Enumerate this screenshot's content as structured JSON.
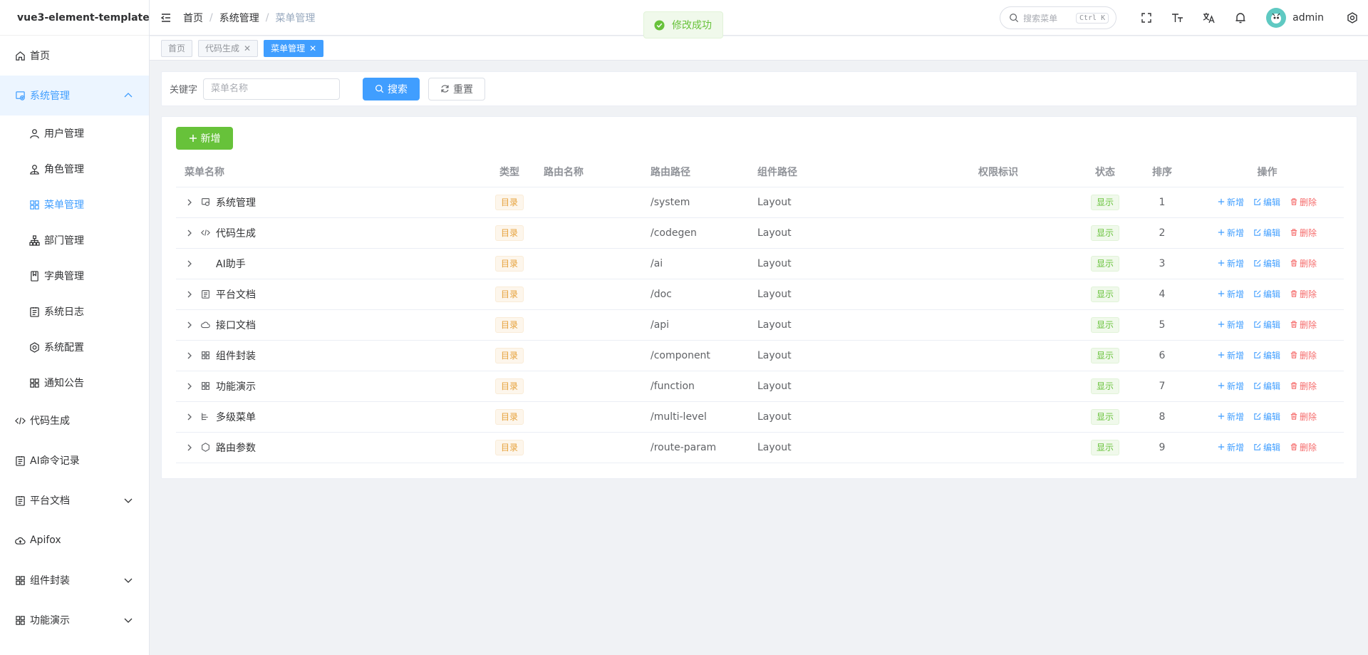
{
  "app": {
    "title": "vue3-element-template"
  },
  "sidebar": {
    "items": [
      {
        "label": "首页",
        "icon": "home-icon"
      },
      {
        "label": "系统管理",
        "icon": "system-icon",
        "expanded": true
      },
      {
        "label": "用户管理",
        "icon": "user-icon"
      },
      {
        "label": "角色管理",
        "icon": "role-icon"
      },
      {
        "label": "菜单管理",
        "icon": "grid-icon",
        "active": true
      },
      {
        "label": "部门管理",
        "icon": "org-icon"
      },
      {
        "label": "字典管理",
        "icon": "book-icon"
      },
      {
        "label": "系统日志",
        "icon": "log-icon"
      },
      {
        "label": "系统配置",
        "icon": "hex-settings-icon"
      },
      {
        "label": "通知公告",
        "icon": "grid-icon"
      },
      {
        "label": "代码生成",
        "icon": "code-icon"
      },
      {
        "label": "AI命令记录",
        "icon": "doc-icon"
      },
      {
        "label": "平台文档",
        "icon": "doc-icon",
        "has_children": true
      },
      {
        "label": "Apifox",
        "icon": "cloud-icon"
      },
      {
        "label": "组件封装",
        "icon": "grid-icon",
        "has_children": true
      },
      {
        "label": "功能演示",
        "icon": "grid-icon",
        "has_children": true
      }
    ]
  },
  "header": {
    "breadcrumb": [
      "首页",
      "系统管理",
      "菜单管理"
    ],
    "search_placeholder": "搜索菜单",
    "search_shortcut": "Ctrl K",
    "username": "admin"
  },
  "toast": {
    "message": "修改成功"
  },
  "tags": [
    {
      "label": "首页",
      "closable": false
    },
    {
      "label": "代码生成",
      "closable": true
    },
    {
      "label": "菜单管理",
      "closable": true,
      "active": true
    }
  ],
  "search": {
    "keyword_label": "关键字",
    "keyword_placeholder": "菜单名称",
    "search_button": "搜索",
    "reset_button": "重置"
  },
  "table": {
    "add_button": "新增",
    "columns": [
      "菜单名称",
      "类型",
      "路由名称",
      "路由路径",
      "组件路径",
      "权限标识",
      "状态",
      "排序",
      "操作"
    ],
    "op_labels": {
      "add": "新增",
      "edit": "编辑",
      "delete": "删除"
    },
    "rows": [
      {
        "name": "系统管理",
        "icon": "system-icon",
        "type": "目录",
        "route_name": "",
        "path": "/system",
        "component": "Layout",
        "perm": "",
        "status": "显示",
        "sort": "1"
      },
      {
        "name": "代码生成",
        "icon": "code-icon",
        "type": "目录",
        "route_name": "",
        "path": "/codegen",
        "component": "Layout",
        "perm": "",
        "status": "显示",
        "sort": "2"
      },
      {
        "name": "AI助手",
        "icon": "",
        "type": "目录",
        "route_name": "",
        "path": "/ai",
        "component": "Layout",
        "perm": "",
        "status": "显示",
        "sort": "3"
      },
      {
        "name": "平台文档",
        "icon": "doc-icon",
        "type": "目录",
        "route_name": "",
        "path": "/doc",
        "component": "Layout",
        "perm": "",
        "status": "显示",
        "sort": "4"
      },
      {
        "name": "接口文档",
        "icon": "cloud-icon",
        "type": "目录",
        "route_name": "",
        "path": "/api",
        "component": "Layout",
        "perm": "",
        "status": "显示",
        "sort": "5"
      },
      {
        "name": "组件封装",
        "icon": "grid-icon",
        "type": "目录",
        "route_name": "",
        "path": "/component",
        "component": "Layout",
        "perm": "",
        "status": "显示",
        "sort": "6"
      },
      {
        "name": "功能演示",
        "icon": "grid-icon",
        "type": "目录",
        "route_name": "",
        "path": "/function",
        "component": "Layout",
        "perm": "",
        "status": "显示",
        "sort": "7"
      },
      {
        "name": "多级菜单",
        "icon": "tree-icon",
        "type": "目录",
        "route_name": "",
        "path": "/multi-level",
        "component": "Layout",
        "perm": "",
        "status": "显示",
        "sort": "8"
      },
      {
        "name": "路由参数",
        "icon": "route-icon",
        "type": "目录",
        "route_name": "",
        "path": "/route-param",
        "component": "Layout",
        "perm": "",
        "status": "显示",
        "sort": "9"
      }
    ]
  },
  "colors": {
    "primary": "#409eff",
    "success": "#67c23a",
    "warning": "#e6a23c",
    "danger": "#f56c6c"
  }
}
